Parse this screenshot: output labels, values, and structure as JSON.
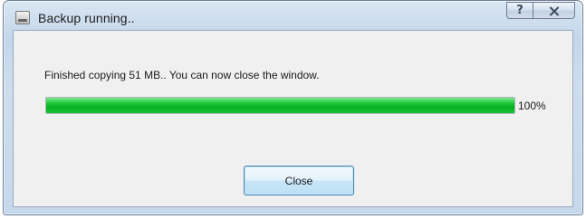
{
  "window": {
    "title": "Backup running..",
    "help_button": "?",
    "close_icon": "close-x-icon",
    "app_icon": "drive-icon"
  },
  "content": {
    "message": "Finished copying 51 MB.. You can now close the window.",
    "progress": {
      "value_percent": 100,
      "label": "100%",
      "fill_color": "#14c02f"
    },
    "close_button_label": "Close"
  }
}
